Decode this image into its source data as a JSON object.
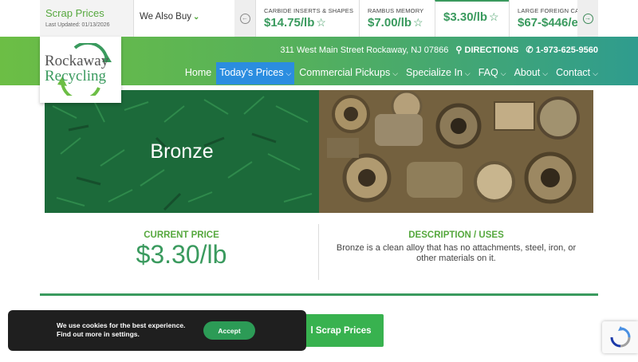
{
  "topbar": {
    "scrap_prices_title": "Scrap Prices",
    "last_updated": "Last Updated: 01/13/2026",
    "we_also_buy": "We Also Buy",
    "ticker": [
      {
        "label": "CARBIDE INSERTS & SHAPES",
        "price": "$14.75/lb"
      },
      {
        "label": "RAMBUS MEMORY",
        "price": "$7.00/lb"
      },
      {
        "label": "",
        "price": "$3.30/lb"
      },
      {
        "label": "LARGE FOREIGN CA",
        "price": "$67-$446/e"
      }
    ]
  },
  "header": {
    "address": "311 West Main Street Rockaway, NJ 07866",
    "directions": "DIRECTIONS",
    "phone": "1-973-625-9560",
    "logo_line1": "Rockaway",
    "logo_line2": "Recycling",
    "nav": [
      {
        "label": "Home",
        "dropdown": false
      },
      {
        "label": "Today's Prices",
        "dropdown": true
      },
      {
        "label": "Commercial Pickups",
        "dropdown": true
      },
      {
        "label": "Specialize In",
        "dropdown": true
      },
      {
        "label": "FAQ",
        "dropdown": true
      },
      {
        "label": "About",
        "dropdown": true
      },
      {
        "label": "Contact",
        "dropdown": true
      }
    ]
  },
  "hero": {
    "title": "Bronze"
  },
  "details": {
    "price_heading": "CURRENT PRICE",
    "price_value": "$3.30/lb",
    "description_heading": "DESCRIPTION / USES",
    "description_text": "Bronze is a clean alloy that has no attachments, steel, iron, or other materials on it."
  },
  "cta": {
    "all_prices_label": "l Scrap Prices"
  },
  "cookie": {
    "line1": "We use cookies for the best experience.",
    "line2": "Find out more in settings.",
    "accept_label": "Accept"
  },
  "colors": {
    "brand_green": "#56a83e",
    "dark_green": "#3a9a5e",
    "nav_active": "#2b8de0"
  }
}
